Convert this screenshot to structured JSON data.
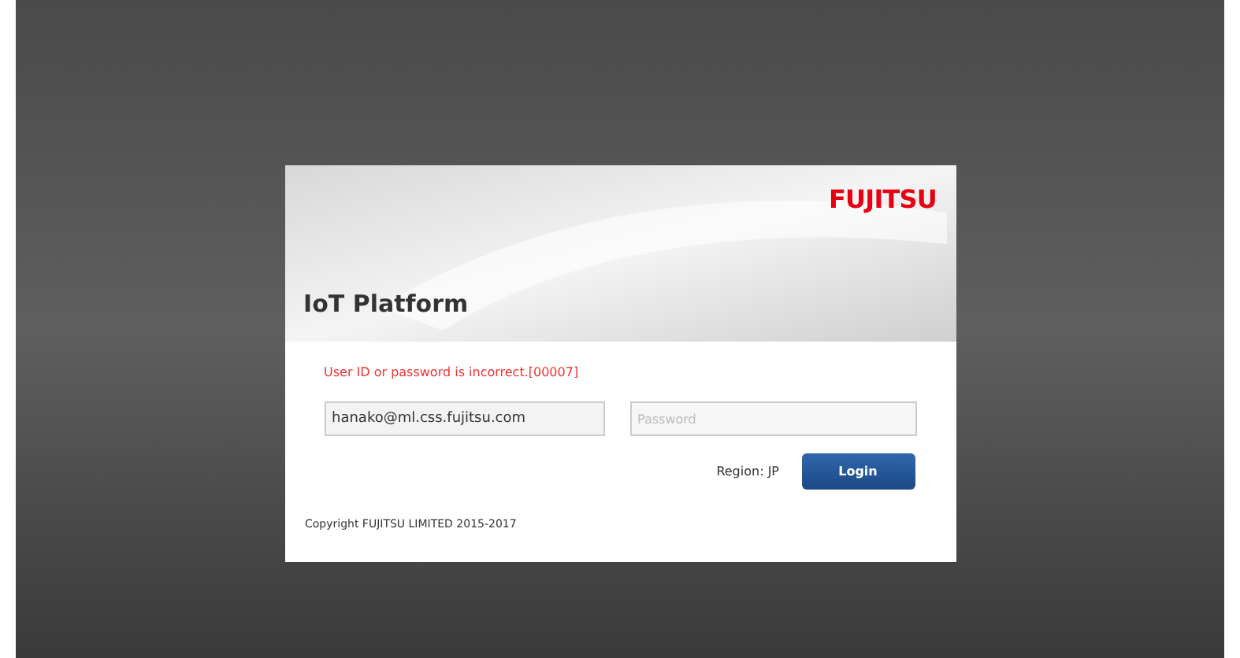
{
  "header": {
    "logo": "FUJITSU",
    "title": "IoT Platform"
  },
  "error": "User ID or password is incorrect.[00007]",
  "user_id": {
    "value": "hanako@ml.css.fujitsu.com"
  },
  "password": {
    "placeholder": "Password"
  },
  "region": "Region: JP",
  "login_button": "Login",
  "copyright": "Copyright FUJITSU LIMITED 2015-2017"
}
